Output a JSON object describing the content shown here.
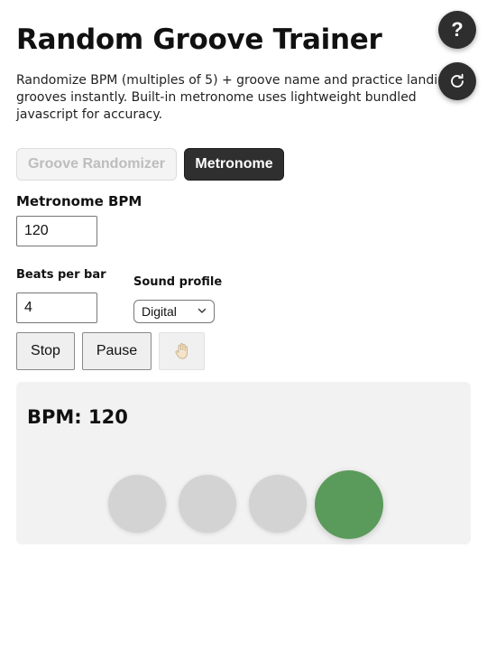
{
  "app": {
    "title": "Random Groove Trainer",
    "description": "Randomize BPM (multiples of 5) + groove name and practice landing grooves instantly. Built-in metronome uses lightweight bundled javascript for accuracy."
  },
  "header": {
    "help_label": "?",
    "help_icon": "question-icon",
    "reset_icon": "refresh-icon"
  },
  "tabs": [
    {
      "label": "Groove Randomizer",
      "active": false
    },
    {
      "label": "Metronome",
      "active": true
    }
  ],
  "metronome": {
    "bpm_label": "Metronome BPM",
    "bpm_value": "120",
    "beats_label": "Beats per bar",
    "beats_value": "4",
    "sound_label": "Sound profile",
    "sound_value": "Digital",
    "controls": {
      "stop_label": "Stop",
      "pause_label": "Pause",
      "tap_icon": "hand-icon"
    },
    "display": {
      "bpm_text": "BPM: 120",
      "beats": [
        {
          "active": false
        },
        {
          "active": false
        },
        {
          "active": false
        },
        {
          "active": true
        }
      ]
    }
  },
  "colors": {
    "dark": "#2f2f2f",
    "beat_idle": "#d3d3d3",
    "beat_active": "#5a9a5a",
    "panel_bg": "#f2f2f2"
  }
}
